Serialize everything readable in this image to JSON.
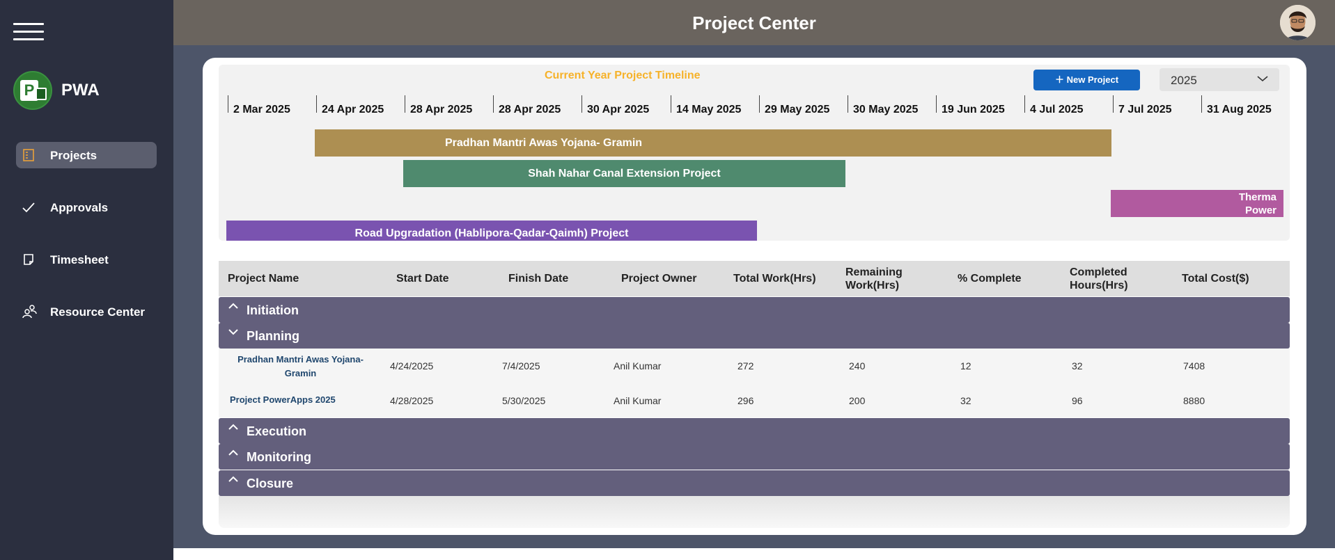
{
  "sidebar": {
    "app_name": "PWA",
    "nav": [
      {
        "label": "Projects",
        "icon": "projects-icon",
        "active": true
      },
      {
        "label": "Approvals",
        "icon": "checkmark-icon",
        "active": false
      },
      {
        "label": "Timesheet",
        "icon": "timesheet-icon",
        "active": false
      },
      {
        "label": "Resource Center",
        "icon": "people-icon",
        "active": false
      }
    ]
  },
  "header": {
    "title": "Project Center"
  },
  "timeline": {
    "title": "Current Year Project Timeline",
    "new_project_label": "New Project",
    "year": "2025",
    "ticks": [
      "2 Mar 2025",
      "24 Apr 2025",
      "28 Apr 2025",
      "28 Apr 2025",
      "30 Apr 2025",
      "14 May 2025",
      "29 May 2025",
      "30 May 2025",
      "19 Jun 2025",
      "4 Jul 2025",
      "7 Jul 2025",
      "31 Aug 2025"
    ],
    "bars": [
      {
        "label": "Pradhan Mantri Awas Yojana- Gramin",
        "start": "24 Apr 2025",
        "end": "7 Jul 2025",
        "color": "#ad8f52"
      },
      {
        "label": "Shah Nahar Canal Extension Project",
        "start": "28 Apr 2025",
        "end": "30 May 2025",
        "color": "#4f8a6e"
      },
      {
        "label": "Therma Power",
        "start": "7 Jul 2025",
        "end": "31 Aug 2025",
        "color": "#b15a9f"
      },
      {
        "label": "Road Upgradation (Hablipora-Qadar-Qaimh) Project",
        "start": "2 Mar 2025",
        "end": "29 May 2025",
        "color": "#7a53b0"
      }
    ]
  },
  "grid": {
    "columns": [
      "Project Name",
      "Start Date",
      "Finish Date",
      "Project Owner",
      "Total Work(Hrs)",
      "Remaining Work(Hrs)",
      "% Complete",
      "Completed Hours(Hrs)",
      "Total Cost($)"
    ],
    "groups": [
      {
        "label": "Initiation",
        "expanded": false
      },
      {
        "label": "Planning",
        "expanded": true
      },
      {
        "label": "Execution",
        "expanded": false
      },
      {
        "label": "Monitoring",
        "expanded": false
      },
      {
        "label": "Closure",
        "expanded": false
      }
    ],
    "planning_rows": [
      {
        "name": "Pradhan Mantri Awas Yojana-Gramin",
        "start": "4/24/2025",
        "finish": "7/4/2025",
        "owner": "Anil Kumar",
        "total_work": "272",
        "remaining": "240",
        "pct": "12",
        "completed": "32",
        "cost": "7408"
      },
      {
        "name": "Project PowerApps 2025",
        "start": "4/28/2025",
        "finish": "5/30/2025",
        "owner": "Anil Kumar",
        "total_work": "296",
        "remaining": "200",
        "pct": "32",
        "completed": "96",
        "cost": "8880"
      }
    ]
  },
  "colors": {
    "sidebar": "#2b2f3f",
    "header": "#6a645e",
    "group": "#635f7c",
    "accent": "#1566c0",
    "timeline_title": "#f6b22a"
  }
}
